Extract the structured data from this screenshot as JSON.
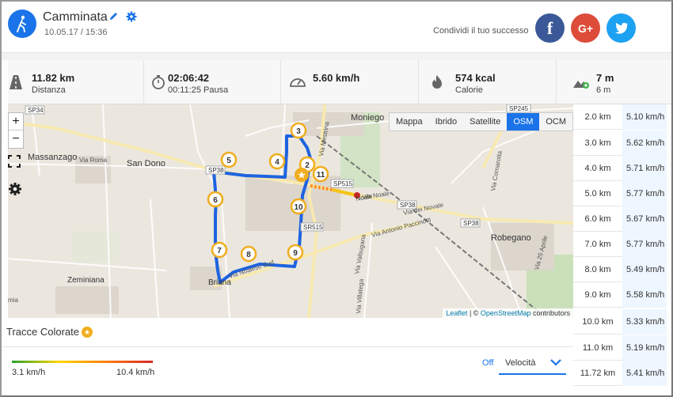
{
  "header": {
    "title": "Camminata",
    "date": "10.05.17 / 15:36",
    "share_label": "Condividi il tuo successo",
    "social": {
      "facebook": "f",
      "googleplus": "G+",
      "twitter": "t"
    }
  },
  "stats": [
    {
      "icon": "distance-icon",
      "value": "11.82 km",
      "label": "Distanza"
    },
    {
      "icon": "stopwatch-icon",
      "value": "02:06:42",
      "label": "00:11:25 Pausa"
    },
    {
      "icon": "speedometer-icon",
      "value": "5.60 km/h",
      "label": ""
    },
    {
      "icon": "flame-icon",
      "value": "574 kcal",
      "label": "Calorie"
    },
    {
      "icon": "elevation-icon",
      "value": "7 m",
      "label": "6 m"
    }
  ],
  "map": {
    "layers": [
      "Mappa",
      "Ibrido",
      "Satellite",
      "OSM",
      "OCM"
    ],
    "active_layer": "OSM",
    "labels": [
      "Moniego",
      "Massanzago",
      "San Dono",
      "Zeminiana",
      "Briana",
      "Robegano",
      "Noale",
      "SP34",
      "SP245",
      "SP38",
      "SP38",
      "SP515",
      "SR515",
      "SP38",
      "Via Roma",
      "Via Noale",
      "Via dei Novale",
      "Via Antonio Paccinotti",
      "Via Mestrina",
      "Via Cornarotta",
      "Via 25 Aprile",
      "Via Valsugana",
      "Via Villatega",
      "Via Noalese Sud",
      "mia"
    ],
    "markers": [
      "2",
      "3",
      "4",
      "5",
      "6",
      "7",
      "8",
      "9",
      "10",
      "11"
    ],
    "attribution": {
      "leaflet": "Leaflet",
      "sep": " | © ",
      "osm": "OpenStreetMap",
      "rest": " contributors"
    },
    "zoom_in": "+",
    "zoom_out": "−"
  },
  "splits": [
    {
      "km": "2.0 km",
      "speed": "5.10 km/h"
    },
    {
      "km": "3.0 km",
      "speed": "5.62 km/h"
    },
    {
      "km": "4.0 km",
      "speed": "5.71 km/h"
    },
    {
      "km": "5.0 km",
      "speed": "5.77 km/h"
    },
    {
      "km": "6.0 km",
      "speed": "5.67 km/h"
    },
    {
      "km": "7.0 km",
      "speed": "5.77 km/h"
    },
    {
      "km": "8.0 km",
      "speed": "5.49 km/h"
    },
    {
      "km": "9.0 km",
      "speed": "5.58 km/h"
    },
    {
      "km": "10.0 km",
      "speed": "5.33 km/h"
    },
    {
      "km": "11.0 km",
      "speed": "5.19 km/h"
    },
    {
      "km": "11.72 km",
      "speed": "5.41 km/h"
    }
  ],
  "colored_tracks": {
    "title": "Tracce Colorate",
    "min": "3.1 km/h",
    "max": "10.4 km/h",
    "off_label": "Off",
    "selected": "Velocità"
  },
  "colors": {
    "accent": "#1a73e8",
    "route": "#1e63e0",
    "marker": "#f0ad1e",
    "facebook": "#3b5998",
    "googleplus": "#dd4b39",
    "twitter": "#1da1f2"
  }
}
